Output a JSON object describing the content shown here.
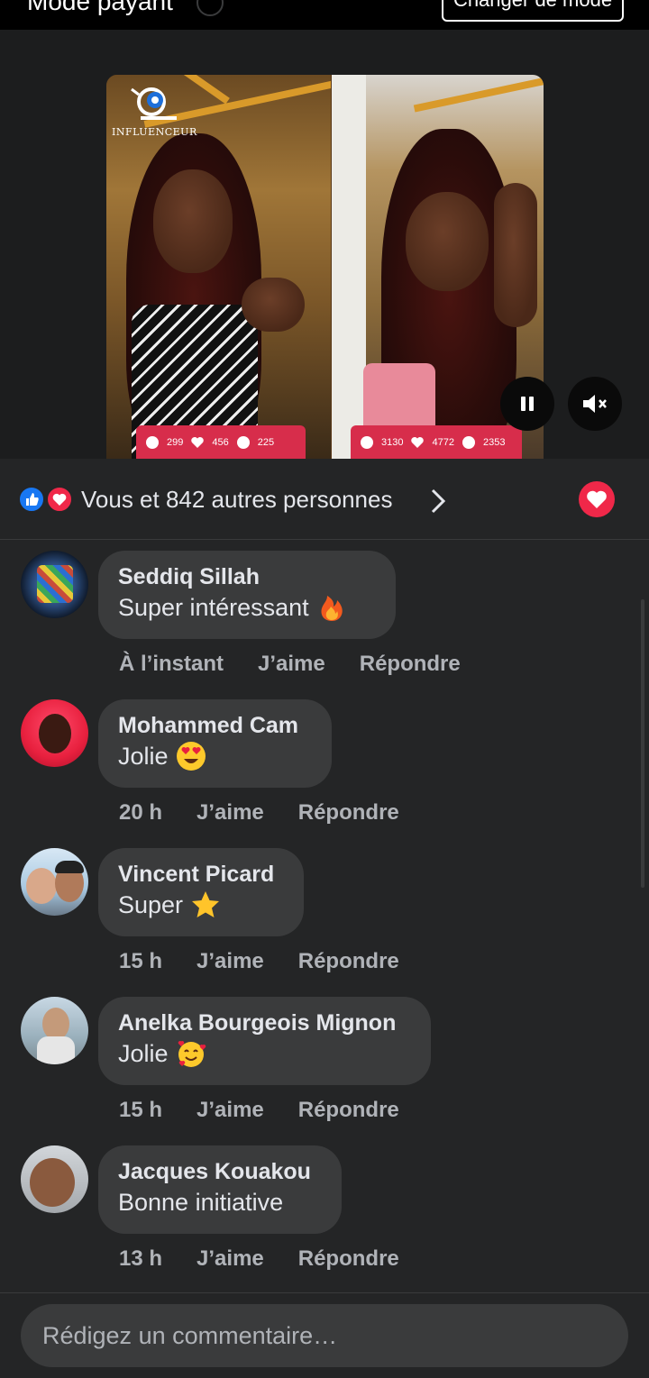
{
  "topbar": {
    "mode_label": "Mode payant",
    "change_mode_label": "Changer de mode"
  },
  "video": {
    "logo_text": "INFLUENCEUR",
    "left_stats": {
      "comments": "299",
      "likes": "456",
      "views": "225"
    },
    "right_stats": {
      "comments": "3130",
      "likes": "4772",
      "views": "2353"
    }
  },
  "reactions": {
    "summary": "Vous et 842 autres personnes"
  },
  "comments": [
    {
      "author": "Seddiq Sillah",
      "text": "Super intéressant",
      "emoji": "fire",
      "time": "À l’instant",
      "like": "J’aime",
      "reply": "Répondre"
    },
    {
      "author": "Mohammed Cam",
      "text": "Jolie",
      "emoji": "heart-eyes",
      "time": "20 h",
      "like": "J’aime",
      "reply": "Répondre"
    },
    {
      "author": "Vincent Picard",
      "text": "Super",
      "emoji": "star",
      "time": "15 h",
      "like": "J’aime",
      "reply": "Répondre"
    },
    {
      "author": "Anelka Bourgeois Mignon",
      "text": "Jolie",
      "emoji": "smiling-hearts",
      "time": "15 h",
      "like": "J’aime",
      "reply": "Répondre"
    },
    {
      "author": "Jacques Kouakou",
      "text": "Bonne initiative",
      "emoji": "",
      "time": "13 h",
      "like": "J’aime",
      "reply": "Répondre"
    }
  ],
  "composer": {
    "placeholder": "Rédigez un commentaire…"
  },
  "colors": {
    "background": "#242526",
    "bubble": "#3a3b3c",
    "accent_red": "#d72d4b",
    "like_blue": "#1877f2",
    "love_red": "#f02849"
  }
}
